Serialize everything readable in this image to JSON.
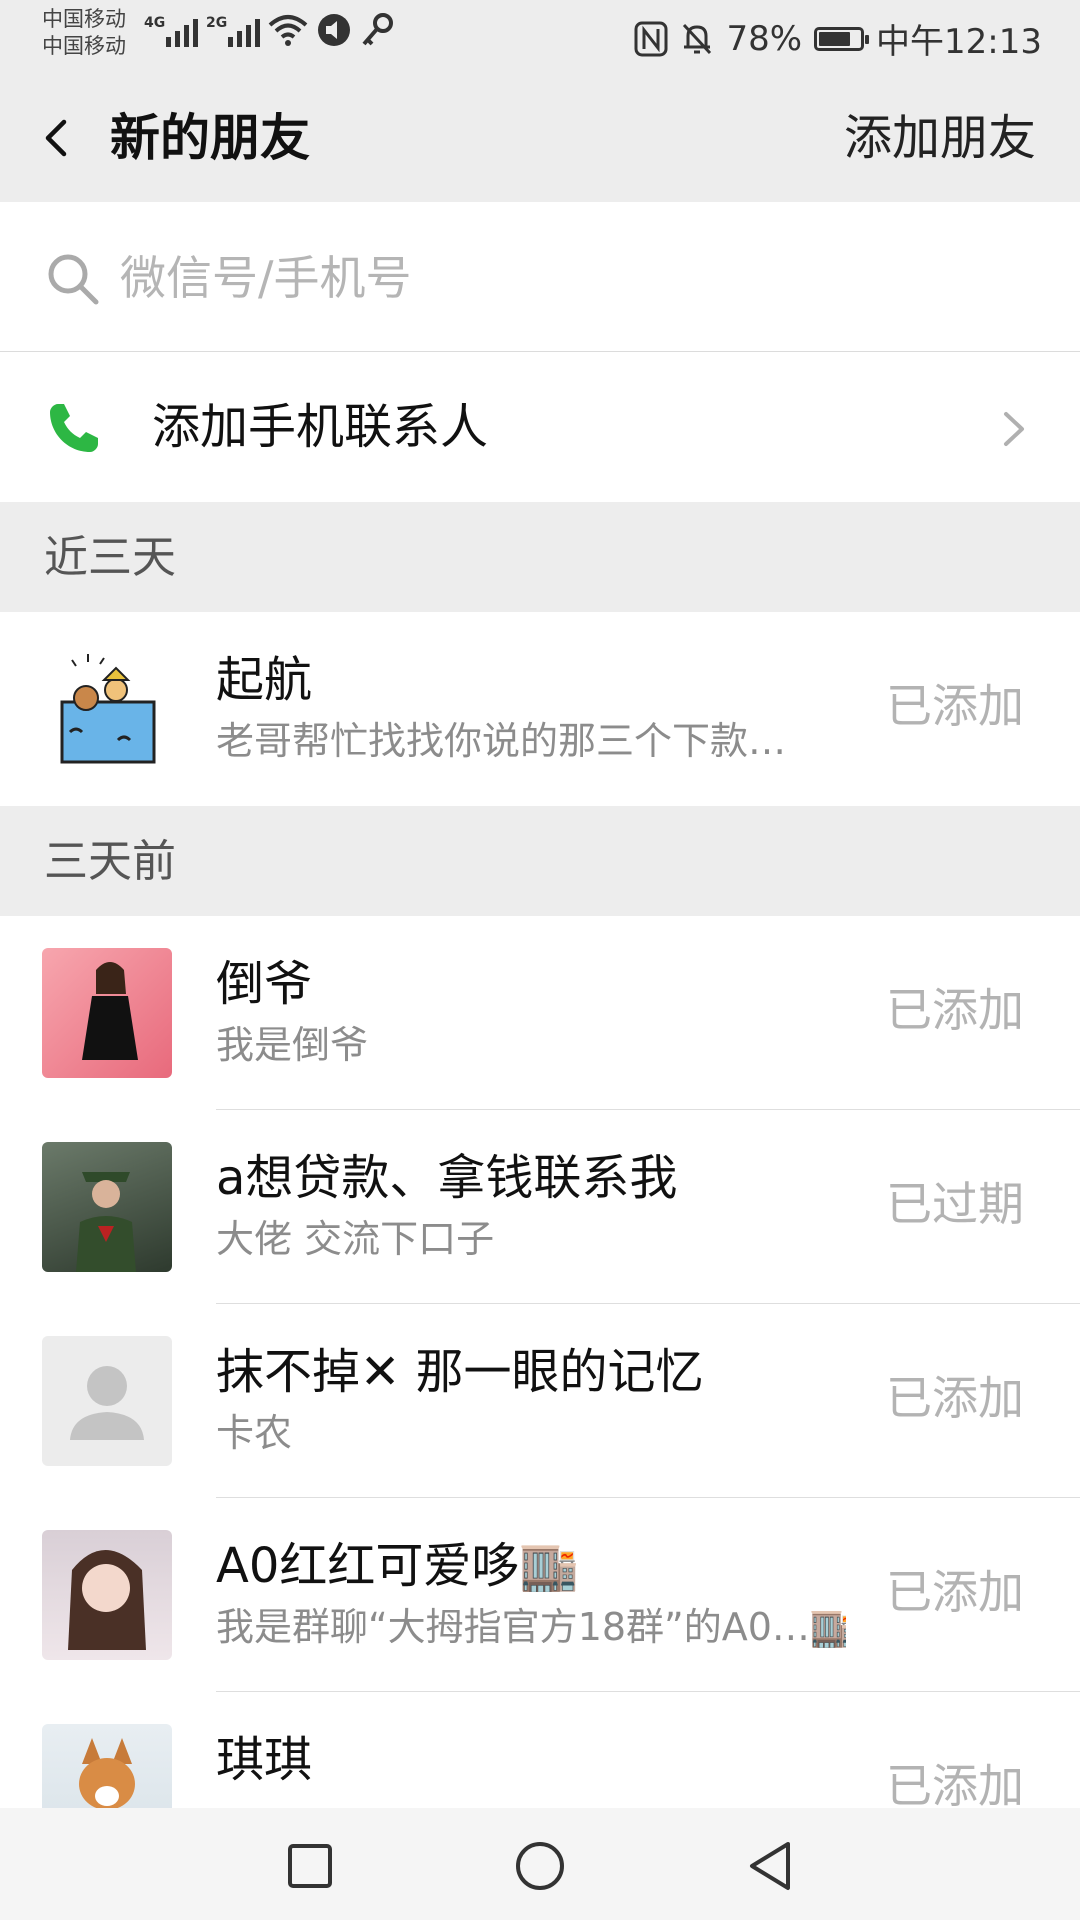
{
  "status_bar": {
    "carrier_1": "中国移动",
    "carrier_2": "中国移动",
    "network_1": "4G",
    "network_2": "2G",
    "battery_percent": "78%",
    "battery_level": 0.78,
    "time": "中午12:13"
  },
  "header": {
    "title": "新的朋友",
    "action": "添加朋友"
  },
  "search": {
    "placeholder": "微信号/手机号"
  },
  "add_contacts": {
    "label": "添加手机联系人"
  },
  "sections": [
    {
      "title": "近三天",
      "items": [
        {
          "name": "起航",
          "message": "老哥帮忙找找你说的那三个下款…",
          "status": "已添加",
          "avatar": "cartoon"
        }
      ]
    },
    {
      "title": "三天前",
      "items": [
        {
          "name": "倒爷",
          "message": "我是倒爷",
          "status": "已添加",
          "avatar": "photo-pink"
        },
        {
          "name": "a想贷款、拿钱联系我",
          "message": "大佬 交流下口子",
          "status": "已过期",
          "avatar": "photo-soldier"
        },
        {
          "name": "抹不掉✕ 那一眼的记忆",
          "message": "卡农",
          "status": "已添加",
          "avatar": "default-person-icon"
        },
        {
          "name": "A0红红可爱哆🏬",
          "message": "我是群聊“大拇指官方18群”的A0…🏬",
          "status": "已添加",
          "avatar": "photo-girl"
        },
        {
          "name": "琪琪",
          "message": "",
          "status": "已添加",
          "avatar": "photo-dog"
        }
      ]
    }
  ],
  "colors": {
    "background": "#ededed",
    "accent_green": "#2db744",
    "muted_text": "#b3b3b3"
  }
}
